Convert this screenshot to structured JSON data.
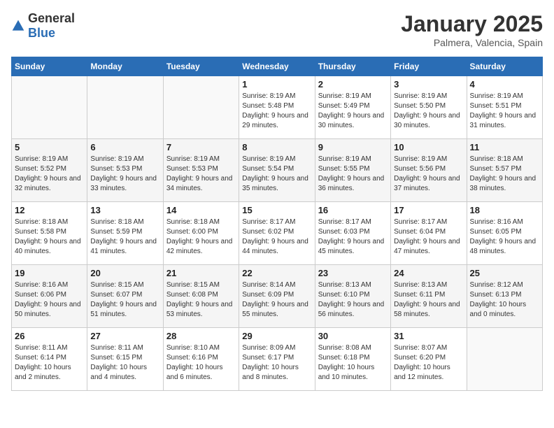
{
  "header": {
    "logo_general": "General",
    "logo_blue": "Blue",
    "title": "January 2025",
    "subtitle": "Palmera, Valencia, Spain"
  },
  "days_of_week": [
    "Sunday",
    "Monday",
    "Tuesday",
    "Wednesday",
    "Thursday",
    "Friday",
    "Saturday"
  ],
  "weeks": [
    [
      {
        "day": "",
        "info": ""
      },
      {
        "day": "",
        "info": ""
      },
      {
        "day": "",
        "info": ""
      },
      {
        "day": "1",
        "info": "Sunrise: 8:19 AM\nSunset: 5:48 PM\nDaylight: 9 hours and 29 minutes."
      },
      {
        "day": "2",
        "info": "Sunrise: 8:19 AM\nSunset: 5:49 PM\nDaylight: 9 hours and 30 minutes."
      },
      {
        "day": "3",
        "info": "Sunrise: 8:19 AM\nSunset: 5:50 PM\nDaylight: 9 hours and 30 minutes."
      },
      {
        "day": "4",
        "info": "Sunrise: 8:19 AM\nSunset: 5:51 PM\nDaylight: 9 hours and 31 minutes."
      }
    ],
    [
      {
        "day": "5",
        "info": "Sunrise: 8:19 AM\nSunset: 5:52 PM\nDaylight: 9 hours and 32 minutes."
      },
      {
        "day": "6",
        "info": "Sunrise: 8:19 AM\nSunset: 5:53 PM\nDaylight: 9 hours and 33 minutes."
      },
      {
        "day": "7",
        "info": "Sunrise: 8:19 AM\nSunset: 5:53 PM\nDaylight: 9 hours and 34 minutes."
      },
      {
        "day": "8",
        "info": "Sunrise: 8:19 AM\nSunset: 5:54 PM\nDaylight: 9 hours and 35 minutes."
      },
      {
        "day": "9",
        "info": "Sunrise: 8:19 AM\nSunset: 5:55 PM\nDaylight: 9 hours and 36 minutes."
      },
      {
        "day": "10",
        "info": "Sunrise: 8:19 AM\nSunset: 5:56 PM\nDaylight: 9 hours and 37 minutes."
      },
      {
        "day": "11",
        "info": "Sunrise: 8:18 AM\nSunset: 5:57 PM\nDaylight: 9 hours and 38 minutes."
      }
    ],
    [
      {
        "day": "12",
        "info": "Sunrise: 8:18 AM\nSunset: 5:58 PM\nDaylight: 9 hours and 40 minutes."
      },
      {
        "day": "13",
        "info": "Sunrise: 8:18 AM\nSunset: 5:59 PM\nDaylight: 9 hours and 41 minutes."
      },
      {
        "day": "14",
        "info": "Sunrise: 8:18 AM\nSunset: 6:00 PM\nDaylight: 9 hours and 42 minutes."
      },
      {
        "day": "15",
        "info": "Sunrise: 8:17 AM\nSunset: 6:02 PM\nDaylight: 9 hours and 44 minutes."
      },
      {
        "day": "16",
        "info": "Sunrise: 8:17 AM\nSunset: 6:03 PM\nDaylight: 9 hours and 45 minutes."
      },
      {
        "day": "17",
        "info": "Sunrise: 8:17 AM\nSunset: 6:04 PM\nDaylight: 9 hours and 47 minutes."
      },
      {
        "day": "18",
        "info": "Sunrise: 8:16 AM\nSunset: 6:05 PM\nDaylight: 9 hours and 48 minutes."
      }
    ],
    [
      {
        "day": "19",
        "info": "Sunrise: 8:16 AM\nSunset: 6:06 PM\nDaylight: 9 hours and 50 minutes."
      },
      {
        "day": "20",
        "info": "Sunrise: 8:15 AM\nSunset: 6:07 PM\nDaylight: 9 hours and 51 minutes."
      },
      {
        "day": "21",
        "info": "Sunrise: 8:15 AM\nSunset: 6:08 PM\nDaylight: 9 hours and 53 minutes."
      },
      {
        "day": "22",
        "info": "Sunrise: 8:14 AM\nSunset: 6:09 PM\nDaylight: 9 hours and 55 minutes."
      },
      {
        "day": "23",
        "info": "Sunrise: 8:13 AM\nSunset: 6:10 PM\nDaylight: 9 hours and 56 minutes."
      },
      {
        "day": "24",
        "info": "Sunrise: 8:13 AM\nSunset: 6:11 PM\nDaylight: 9 hours and 58 minutes."
      },
      {
        "day": "25",
        "info": "Sunrise: 8:12 AM\nSunset: 6:13 PM\nDaylight: 10 hours and 0 minutes."
      }
    ],
    [
      {
        "day": "26",
        "info": "Sunrise: 8:11 AM\nSunset: 6:14 PM\nDaylight: 10 hours and 2 minutes."
      },
      {
        "day": "27",
        "info": "Sunrise: 8:11 AM\nSunset: 6:15 PM\nDaylight: 10 hours and 4 minutes."
      },
      {
        "day": "28",
        "info": "Sunrise: 8:10 AM\nSunset: 6:16 PM\nDaylight: 10 hours and 6 minutes."
      },
      {
        "day": "29",
        "info": "Sunrise: 8:09 AM\nSunset: 6:17 PM\nDaylight: 10 hours and 8 minutes."
      },
      {
        "day": "30",
        "info": "Sunrise: 8:08 AM\nSunset: 6:18 PM\nDaylight: 10 hours and 10 minutes."
      },
      {
        "day": "31",
        "info": "Sunrise: 8:07 AM\nSunset: 6:20 PM\nDaylight: 10 hours and 12 minutes."
      },
      {
        "day": "",
        "info": ""
      }
    ]
  ]
}
